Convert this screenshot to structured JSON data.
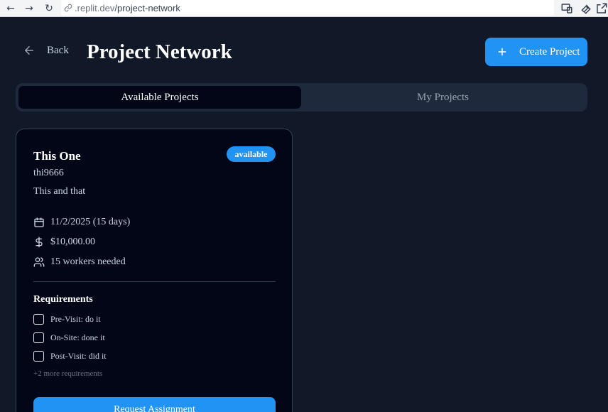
{
  "browser": {
    "url_host": ".replit.dev",
    "url_path": "/project-network"
  },
  "header": {
    "back_label": "Back",
    "title": "Project Network",
    "create_label": "Create Project"
  },
  "tabs": [
    {
      "label": "Available Projects",
      "active": true
    },
    {
      "label": "My Projects",
      "active": false
    }
  ],
  "project": {
    "title": "This One",
    "status": "available",
    "owner": "thi9666",
    "description": "This and that",
    "date": "11/2/2025 (15 days)",
    "budget": "$10,000.00",
    "workers": "15 workers needed",
    "requirements_heading": "Requirements",
    "requirements": [
      {
        "label": "Pre-Visit: do it",
        "checked": false
      },
      {
        "label": "On-Site: done it",
        "checked": false
      },
      {
        "label": "Post-Visit: did it",
        "checked": false
      }
    ],
    "more_requirements": "+2 more requirements",
    "request_label": "Request Assignment"
  },
  "colors": {
    "background": "#111827",
    "accent": "#2193f3",
    "card": "#020617"
  },
  "icons": [
    "arrow-left-icon",
    "plus-icon",
    "calendar-icon",
    "dollar-icon",
    "users-icon"
  ]
}
